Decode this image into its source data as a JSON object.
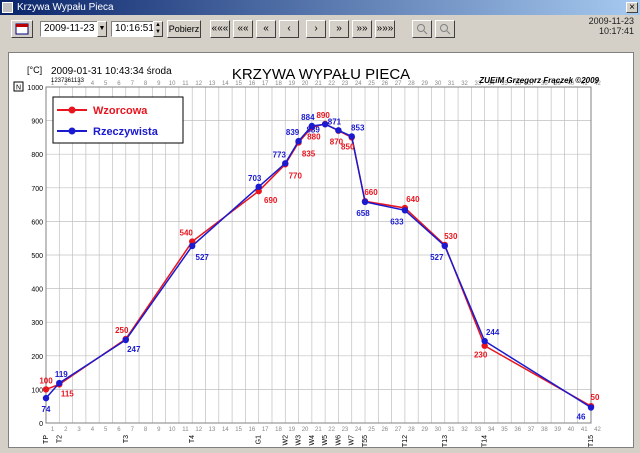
{
  "window": {
    "title": "Krzywa Wypału Pieca",
    "close_glyph": "×"
  },
  "toolbar": {
    "date_value": "2009-11-23",
    "time_value": "10:16:51",
    "fetch_label": "Pobierz",
    "nav_buttons": [
      "«««",
      "««",
      "«",
      "‹",
      "›",
      "»",
      "»»",
      "»»»"
    ],
    "current_date": "2009-11-23",
    "current_time": "10:17:41"
  },
  "chart_header": {
    "unit": "[°C]",
    "run_datetime": "2009-01-31  10:43:34 środa",
    "run_id": "1237361133",
    "title": "KRZYWA WYPAŁU PIECA",
    "credit": "ZUEiM Grzegorz Frączek ©2009",
    "corner_marker": "N"
  },
  "colors": {
    "wzorcowa": "#e8141e",
    "rzeczywista": "#1a1ad0",
    "grid": "#c0c0c0"
  },
  "chart_data": {
    "type": "line",
    "title": "KRZYWA WYPAŁU PIECA",
    "ylabel": "[°C]",
    "ylim": [
      0,
      1000
    ],
    "yticks": [
      0,
      100,
      200,
      300,
      400,
      500,
      600,
      700,
      800,
      900,
      1000
    ],
    "xlim": [
      1,
      42
    ],
    "column_numbers": [
      "1",
      "2",
      "3",
      "4",
      "5",
      "6",
      "7",
      "8",
      "9",
      "10",
      "11",
      "12",
      "13",
      "14",
      "15",
      "16",
      "17",
      "18",
      "19",
      "20",
      "21",
      "22",
      "23",
      "24",
      "25",
      "26",
      "27",
      "28",
      "29",
      "30",
      "31",
      "32",
      "33",
      "34",
      "35",
      "36",
      "37",
      "38",
      "39",
      "40",
      "41",
      "42"
    ],
    "x_points": [
      1,
      2,
      7,
      12,
      17,
      19,
      20,
      21,
      22,
      23,
      24,
      25,
      28,
      31,
      34,
      36,
      42
    ],
    "x_labels": [
      "TP",
      "T2",
      "T3",
      "T4",
      "G1",
      "W2",
      "W3",
      "W4",
      "W5",
      "W6",
      "W7",
      "T55",
      "T12",
      "T13",
      "T14",
      "",
      "T15"
    ],
    "legend": [
      "Wzorcowa",
      "Rzeczywista"
    ],
    "legend_position": "top-left",
    "series": [
      {
        "name": "Wzorcowa",
        "x": [
          1,
          2,
          7,
          12,
          17,
          19,
          20,
          21,
          22,
          23,
          24,
          25,
          28,
          31,
          34,
          36,
          42
        ],
        "values": [
          100,
          115,
          250,
          540,
          690,
          770,
          835,
          880,
          890,
          870,
          850,
          660,
          640,
          530,
          230,
          null,
          50
        ]
      },
      {
        "name": "Rzeczywista",
        "x": [
          1,
          2,
          7,
          12,
          17,
          19,
          20,
          21,
          22,
          23,
          24,
          25,
          28,
          31,
          34,
          36,
          42
        ],
        "values": [
          74,
          119,
          247,
          527,
          703,
          773,
          839,
          884,
          889,
          871,
          853,
          658,
          633,
          527,
          244,
          null,
          46
        ]
      }
    ]
  }
}
